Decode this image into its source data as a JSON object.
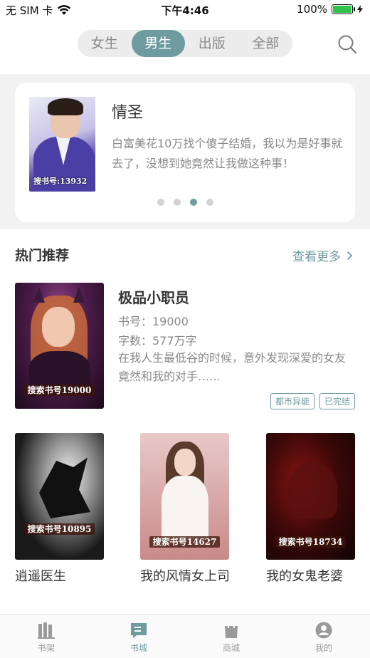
{
  "status_bar": {
    "carrier": "无 SIM 卡",
    "time": "下午4:46",
    "battery": "100%",
    "battery_level": 1.0
  },
  "top_nav": {
    "tabs": [
      {
        "label": "女生",
        "active": false
      },
      {
        "label": "男生",
        "active": true
      },
      {
        "label": "出版",
        "active": false
      },
      {
        "label": "全部",
        "active": false
      }
    ],
    "search_icon": "search-icon"
  },
  "banner": {
    "cover_tag": "搜书号:13932",
    "title": "情圣",
    "description": "白富美花10万找个傻子结婚，我以为是好事就去了，没想到她竟然让我做这种事！",
    "page_count": 4,
    "active_page": 3
  },
  "section": {
    "title": "热门推荐",
    "more_label": "查看更多",
    "more_icon": "chevron-right-icon"
  },
  "featured": {
    "cover_tag": "搜索书号19000",
    "title": "极品小职员",
    "book_no": "书号：19000",
    "word_count": "字数：577万字",
    "description": "在我人生最低谷的时候，意外发现深爱的女友竟然和我的对手……",
    "badges": [
      "都市异能",
      "已完结"
    ]
  },
  "grid_books": [
    {
      "cover_tag": "搜索书号10895",
      "title": "逍遥医生"
    },
    {
      "cover_tag": "搜索书号14627",
      "title": "我的风情女上司"
    },
    {
      "cover_tag": "搜索书号18734",
      "title": "我的女鬼老婆"
    }
  ],
  "tab_bar": [
    {
      "label": "书架",
      "icon": "bookshelf-icon",
      "active": false
    },
    {
      "label": "书城",
      "icon": "bookstore-icon",
      "active": true
    },
    {
      "label": "商城",
      "icon": "shopping-bag-icon",
      "active": false
    },
    {
      "label": "我的",
      "icon": "user-icon",
      "active": false
    }
  ],
  "colors": {
    "accent": "#6e9ba0",
    "battery_green": "#31c24d"
  }
}
